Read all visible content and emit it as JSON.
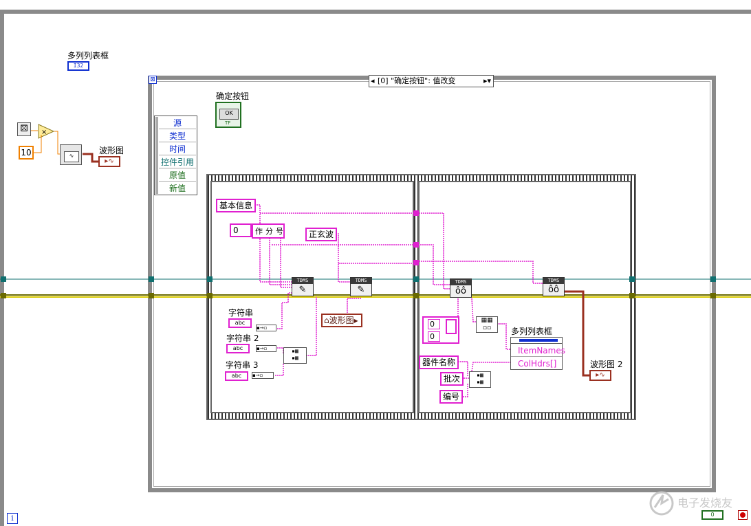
{
  "top_label": "多列列表框",
  "top_indicator": "I32",
  "constant_10": "10",
  "graph_label": "波形图",
  "case_selector": "[0] \"确定按钮\": 值改变",
  "case_arrow": "▸▾",
  "ok_button": {
    "label": "确定按钮",
    "text": "OK",
    "sub": "TF"
  },
  "event_data": [
    "源",
    "类型",
    "时间",
    "控件引用",
    "原值",
    "新值"
  ],
  "frame1": {
    "basic_info": "基本信息",
    "array_index": "0",
    "array_items": [
      "作",
      "分",
      "号"
    ],
    "sine": "正玄波",
    "string_labels": [
      "字符串",
      "字符串 2",
      "字符串 3"
    ],
    "abc": "abc",
    "waveform_ref": "波形图"
  },
  "frame2": {
    "index_a": "0",
    "index_b": "0",
    "listbox_label": "多列列表框",
    "prop_items": "ItemNames",
    "prop_colhdrs": "ColHdrs[]",
    "name_component": "器件名称",
    "name_batch": "批次",
    "name_code": "编号",
    "graph2_label": "波形图 2"
  },
  "tdms_header": "TDMS",
  "info_icon": "i",
  "watermark": "电子发烧友",
  "bottom_run": "0"
}
